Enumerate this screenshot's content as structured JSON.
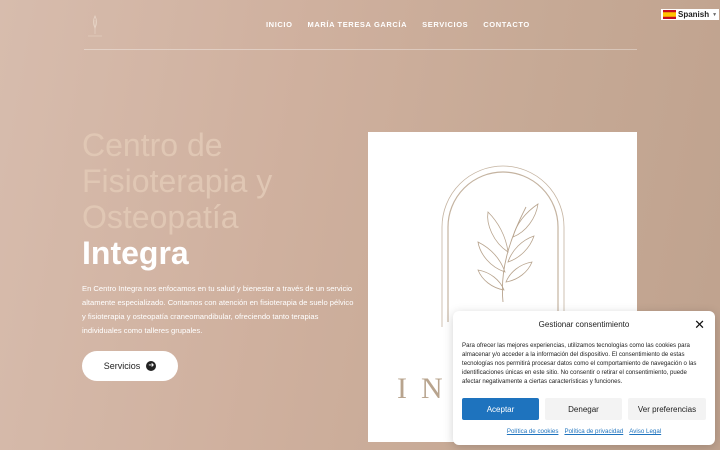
{
  "nav": {
    "items": [
      "INICIO",
      "MARÍA TERESA GARCÍA",
      "SERVICIOS",
      "CONTACTO"
    ]
  },
  "language": {
    "label": "Spanish",
    "icon": "spain-flag-icon"
  },
  "hero": {
    "title_light": "Centro de Fisioterapia y Osteopatía",
    "title_strong": "Integra",
    "description": "En Centro Integra nos enfocamos en tu salud y bienestar a través de un servicio altamente especializado. Contamos con atención en fisioterapia de suelo pélvico y fisioterapia y osteopatía craneomandibular, ofreciendo tanto terapias individuales como talleres grupales.",
    "button_label": "Servicios",
    "card_word": "IN"
  },
  "consent": {
    "title": "Gestionar consentimiento",
    "text": "Para ofrecer las mejores experiencias, utilizamos tecnologías como las cookies para almacenar y/o acceder a la información del dispositivo. El consentimiento de estas tecnologías nos permitirá procesar datos como el comportamiento de navegación o las identificaciones únicas en este sitio. No consentir o retirar el consentimiento, puede afectar negativamente a ciertas características y funciones.",
    "accept": "Aceptar",
    "deny": "Denegar",
    "preferences": "Ver preferencias",
    "links": [
      "Política de cookies",
      "Política de privacidad",
      "Aviso Legal"
    ]
  },
  "colors": {
    "accent": "#1e73be",
    "background": "#cfb09e",
    "title_light": "#e0c7b4"
  }
}
